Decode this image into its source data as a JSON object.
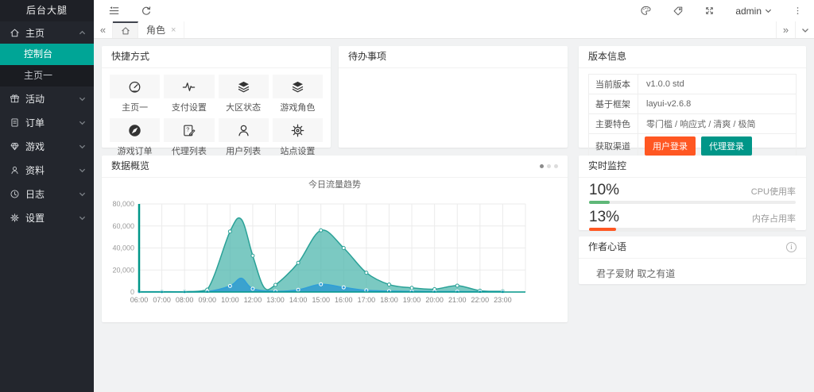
{
  "app": {
    "title": "后台大腿"
  },
  "topbar": {
    "left_icons": [
      "shrink-menu",
      "refresh"
    ],
    "right_icons": [
      "palette",
      "tag",
      "fullscreen",
      "more-vertical"
    ],
    "user": "admin"
  },
  "tabbar": {
    "back": "«",
    "forward": "»",
    "home_icon": "home",
    "tabs": [
      {
        "label": "角色",
        "closable": true,
        "close": "×"
      }
    ]
  },
  "sidebar": {
    "items": [
      {
        "label": "主页",
        "icon": "home",
        "expanded": true,
        "children": [
          {
            "label": "控制台",
            "active": true
          },
          {
            "label": "主页一",
            "active": false
          }
        ]
      },
      {
        "label": "活动",
        "icon": "gift"
      },
      {
        "label": "订单",
        "icon": "order"
      },
      {
        "label": "游戏",
        "icon": "gem"
      },
      {
        "label": "资料",
        "icon": "user"
      },
      {
        "label": "日志",
        "icon": "clock"
      },
      {
        "label": "设置",
        "icon": "gear"
      }
    ]
  },
  "cards": {
    "quick": {
      "title": "快捷方式",
      "items": [
        {
          "label": "主页一",
          "icon": "gauge"
        },
        {
          "label": "支付设置",
          "icon": "pulse"
        },
        {
          "label": "大区状态",
          "icon": "layers"
        },
        {
          "label": "游戏角色",
          "icon": "layers"
        },
        {
          "label": "游戏订单",
          "icon": "compass"
        },
        {
          "label": "代理列表",
          "icon": "survey"
        },
        {
          "label": "用户列表",
          "icon": "person"
        },
        {
          "label": "站点设置",
          "icon": "gear"
        }
      ]
    },
    "todo": {
      "title": "待办事项"
    },
    "version": {
      "title": "版本信息",
      "rows": [
        {
          "label": "当前版本",
          "value": "v1.0.0 std"
        },
        {
          "label": "基于框架",
          "value": "layui-v2.6.8"
        },
        {
          "label": "主要特色",
          "value": "零门槛 / 响应式 / 清爽 / 极简"
        }
      ],
      "channel_row": {
        "label": "获取渠道",
        "buttons": [
          {
            "label": "用户登录",
            "color": "#FF5722"
          },
          {
            "label": "代理登录",
            "color": "#009688"
          }
        ]
      }
    },
    "overview": {
      "title": "数据概览",
      "dot_count": 3
    },
    "monitor": {
      "title": "实时监控",
      "items": [
        {
          "percent": "10%",
          "value": 10,
          "label": "CPU使用率",
          "color": "#5FB878"
        },
        {
          "percent": "13%",
          "value": 13,
          "label": "内存占用率",
          "color": "#FF5722"
        }
      ]
    },
    "quote": {
      "title": "作者心语",
      "content": "君子爱财 取之有道"
    }
  },
  "chart_data": {
    "type": "area",
    "title": "今日流量趋势",
    "x": [
      "06:00",
      "07:00",
      "08:00",
      "09:00",
      "10:00",
      "12:00",
      "13:00",
      "14:00",
      "15:00",
      "16:00",
      "17:00",
      "18:00",
      "19:00",
      "20:00",
      "21:00",
      "22:00",
      "23:00"
    ],
    "ylim": [
      0,
      80000
    ],
    "yticks": [
      "0",
      "20,000",
      "40,000",
      "60,000",
      "80,000"
    ],
    "grid": true,
    "legend_position": "none",
    "axis_color": "#009688",
    "series": [
      {
        "name": "series-1",
        "stroke": "#2aa197",
        "fill": "rgba(72,180,171,0.72)",
        "marker_fill": "#ffffff",
        "marker_stroke": "#2aa197",
        "values": [
          300,
          300,
          300,
          2200,
          55000,
          33000,
          6500,
          26500,
          56000,
          40000,
          17500,
          6800,
          3800,
          2600,
          5800,
          1200,
          600
        ],
        "inter_points": [
          {
            "after": 4,
            "value": 66000
          },
          {
            "after": 5,
            "value": 4200
          }
        ]
      },
      {
        "name": "series-2",
        "stroke": "#2f9fd8",
        "fill": "rgba(44,152,209,0.80)",
        "marker_fill": "#2f9fd8",
        "marker_stroke": "#ffffff",
        "values": [
          100,
          100,
          100,
          400,
          5500,
          3000,
          700,
          2000,
          7000,
          4200,
          1500,
          800,
          500,
          400,
          350,
          250,
          150
        ],
        "inter_points": [
          {
            "after": 4,
            "value": 12500
          }
        ]
      }
    ]
  }
}
